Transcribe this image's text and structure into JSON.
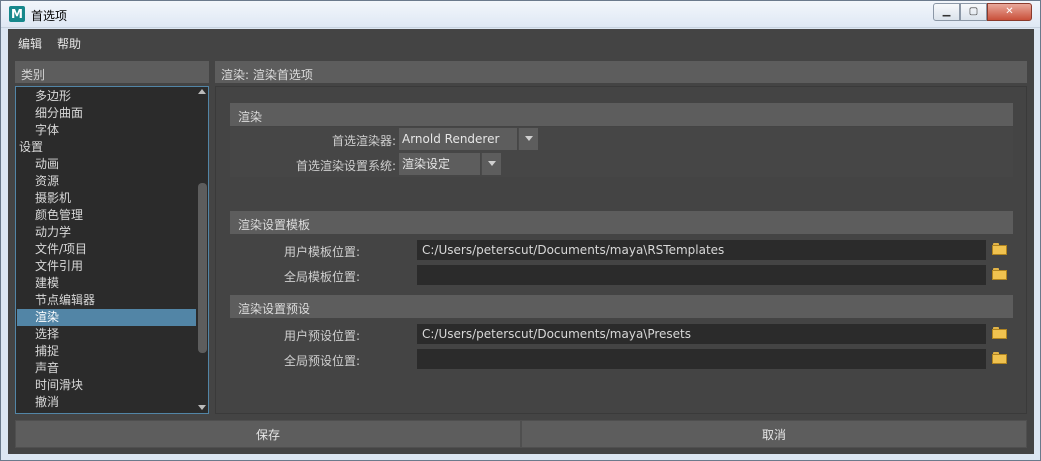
{
  "window": {
    "title": "首选项",
    "app_icon_letter": "M",
    "controls": {
      "minimize": "▁",
      "maximize": "▢",
      "close": "✕"
    }
  },
  "menubar": {
    "edit": "编辑",
    "help": "帮助"
  },
  "categories": {
    "header": "类别",
    "items": [
      {
        "label": "多边形",
        "top": false,
        "selected": false
      },
      {
        "label": "细分曲面",
        "top": false,
        "selected": false
      },
      {
        "label": "字体",
        "top": false,
        "selected": false
      },
      {
        "label": "设置",
        "top": true,
        "selected": false
      },
      {
        "label": "动画",
        "top": false,
        "selected": false
      },
      {
        "label": "资源",
        "top": false,
        "selected": false
      },
      {
        "label": "摄影机",
        "top": false,
        "selected": false
      },
      {
        "label": "颜色管理",
        "top": false,
        "selected": false
      },
      {
        "label": "动力学",
        "top": false,
        "selected": false
      },
      {
        "label": "文件/项目",
        "top": false,
        "selected": false
      },
      {
        "label": "文件引用",
        "top": false,
        "selected": false
      },
      {
        "label": "建模",
        "top": false,
        "selected": false
      },
      {
        "label": "节点编辑器",
        "top": false,
        "selected": false
      },
      {
        "label": "渲染",
        "top": false,
        "selected": true
      },
      {
        "label": "选择",
        "top": false,
        "selected": false
      },
      {
        "label": "捕捉",
        "top": false,
        "selected": false
      },
      {
        "label": "声音",
        "top": false,
        "selected": false
      },
      {
        "label": "时间滑块",
        "top": false,
        "selected": false
      },
      {
        "label": "撤消",
        "top": false,
        "selected": false
      }
    ]
  },
  "panel": {
    "header": "渲染: 渲染首选项",
    "render_section": {
      "title": "渲染",
      "preferred_renderer_label": "首选渲染器:",
      "preferred_renderer_value": "Arnold Renderer",
      "render_settings_system_label": "首选渲染设置系统:",
      "render_settings_system_value": "渲染设定"
    },
    "templates_section": {
      "title": "渲染设置模板",
      "user_label": "用户模板位置:",
      "user_value": "C:/Users/peterscut/Documents/maya\\RSTemplates",
      "global_label": "全局模板位置:",
      "global_value": ""
    },
    "presets_section": {
      "title": "渲染设置预设",
      "user_label": "用户预设位置:",
      "user_value": "C:/Users/peterscut/Documents/maya\\Presets",
      "global_label": "全局预设位置:",
      "global_value": ""
    }
  },
  "buttons": {
    "save": "保存",
    "cancel": "取消"
  },
  "colors": {
    "background": "#444444",
    "header": "#5d5d5d",
    "field": "#2b2b2b",
    "selection": "#5285a6",
    "folder": "#f0c24f"
  }
}
